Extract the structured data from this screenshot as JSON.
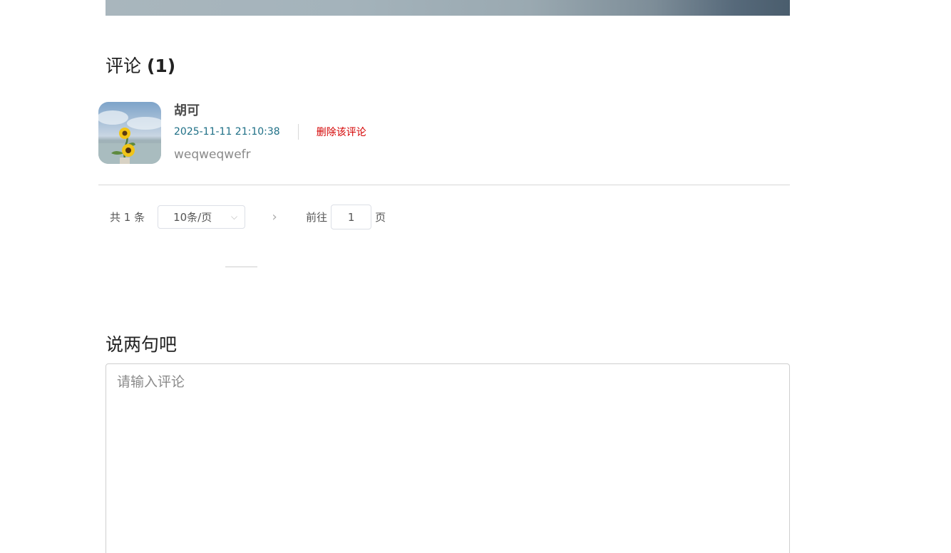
{
  "comments_section": {
    "title": "评论",
    "count_label": "(1)"
  },
  "comments": [
    {
      "author": "胡可",
      "time": "2025-11-11 21:10:38",
      "delete_label": "删除该评论",
      "content": "weqweqwefr"
    }
  ],
  "pagination": {
    "total_label": "共 1 条",
    "page_size_label": "10条/页",
    "next_icon": "chevron-right-icon",
    "goto_label": "前往",
    "current_page": "1",
    "page_unit": "页"
  },
  "compose": {
    "title": "说两句吧",
    "placeholder": "请输入评论"
  },
  "colors": {
    "time": "#1e6f86",
    "delete": "#d40000"
  }
}
